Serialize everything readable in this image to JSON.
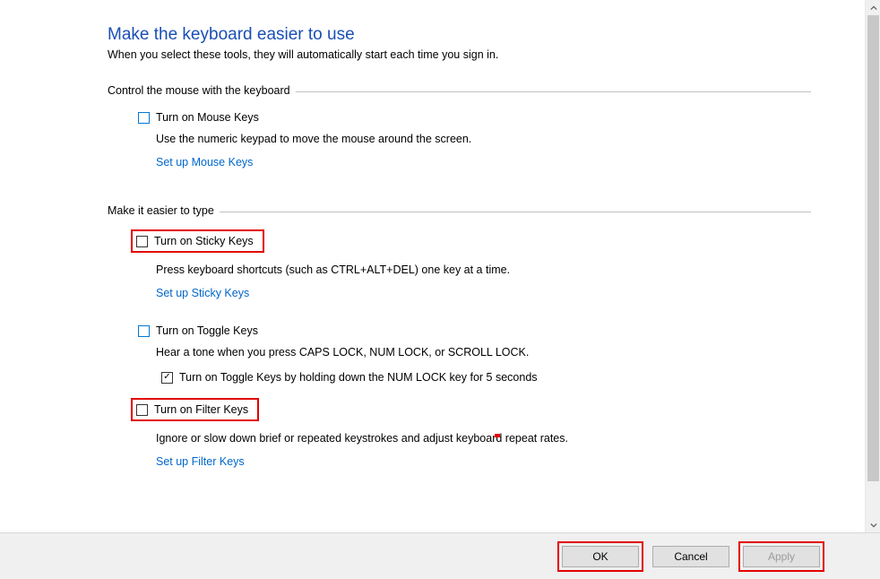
{
  "title": "Make the keyboard easier to use",
  "subtitle": "When you select these tools, they will automatically start each time you sign in.",
  "group1": {
    "label": "Control the mouse with the keyboard",
    "mouseKeys": {
      "label": "Turn on Mouse Keys",
      "checked": false
    },
    "desc": "Use the numeric keypad to move the mouse around the screen.",
    "link": "Set up Mouse Keys"
  },
  "group2": {
    "label": "Make it easier to type",
    "stickyKeys": {
      "label": "Turn on Sticky Keys",
      "checked": false
    },
    "stickyDesc": "Press keyboard shortcuts (such as CTRL+ALT+DEL) one key at a time.",
    "stickyLink": "Set up Sticky Keys",
    "toggleKeys": {
      "label": "Turn on Toggle Keys",
      "checked": false
    },
    "toggleDesc": "Hear a tone when you press CAPS LOCK, NUM LOCK, or SCROLL LOCK.",
    "toggleHold": {
      "label": "Turn on Toggle Keys by holding down the NUM LOCK key for 5 seconds",
      "checked": true
    },
    "filterKeys": {
      "label": "Turn on Filter Keys",
      "checked": false
    },
    "filterDesc": "Ignore or slow down brief or repeated keystrokes and adjust keyboard repeat rates.",
    "filterLink": "Set up Filter Keys"
  },
  "buttons": {
    "ok": "OK",
    "cancel": "Cancel",
    "apply": "Apply"
  }
}
